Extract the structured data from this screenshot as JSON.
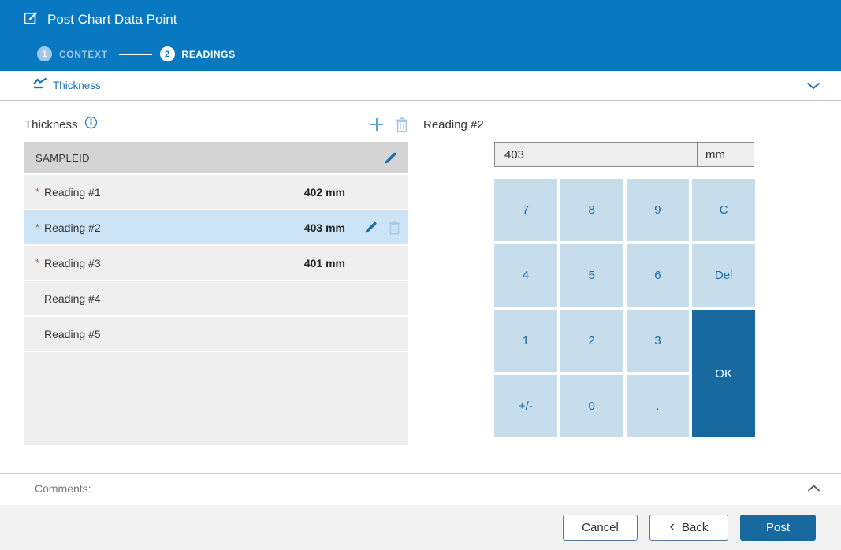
{
  "header": {
    "title": "Post Chart Data Point",
    "steps": [
      {
        "number": "1",
        "label": "CONTEXT",
        "state": "completed"
      },
      {
        "number": "2",
        "label": "READINGS",
        "state": "active"
      }
    ]
  },
  "section": {
    "title": "Thickness"
  },
  "readings_panel": {
    "title": "Thickness",
    "table": {
      "header": "SAMPLEID",
      "rows": [
        {
          "marker": "*",
          "label": "Reading #1",
          "value": "402 mm"
        },
        {
          "marker": "*",
          "label": "Reading #2",
          "value": "403 mm"
        },
        {
          "marker": "*",
          "label": "Reading #3",
          "value": "401 mm"
        },
        {
          "marker": "",
          "label": "Reading #4",
          "value": ""
        },
        {
          "marker": "",
          "label": "Reading #5",
          "value": ""
        }
      ],
      "selected_row": "Reading #2"
    }
  },
  "editor": {
    "title": "Reading #2",
    "value": "403",
    "unit": "mm",
    "keys": [
      "7",
      "8",
      "9",
      "C",
      "4",
      "5",
      "6",
      "Del",
      "1",
      "2",
      "3",
      "OK",
      "+/-",
      "0",
      "."
    ]
  },
  "comments": {
    "label": "Comments:"
  },
  "footer": {
    "cancel_label": "Cancel",
    "back_chevron": "‹",
    "back_label": "Back",
    "post_label": "Post"
  },
  "icons": {
    "header_icon": "edit-pencil-square",
    "section_icon": "run-chart-line",
    "info_icon": "circled-i",
    "add_icon": "plus",
    "delete_icon": "trash-can",
    "edit_icon": "pencil",
    "expand_icon": "chevron-down",
    "collapse_icon": "chevron-up"
  },
  "colors": {
    "header_bg": "#0878c1",
    "accent_blue": "#1b75bb",
    "dark_blue": "#17699f",
    "keypad_bg": "#c7ddec",
    "keypad_text": "#1b6ba3",
    "selected_row_bg": "#cde4f6",
    "table_header_bg": "#d4d4d4",
    "row_bg": "#efefef",
    "required_marker": "#a5682a"
  }
}
